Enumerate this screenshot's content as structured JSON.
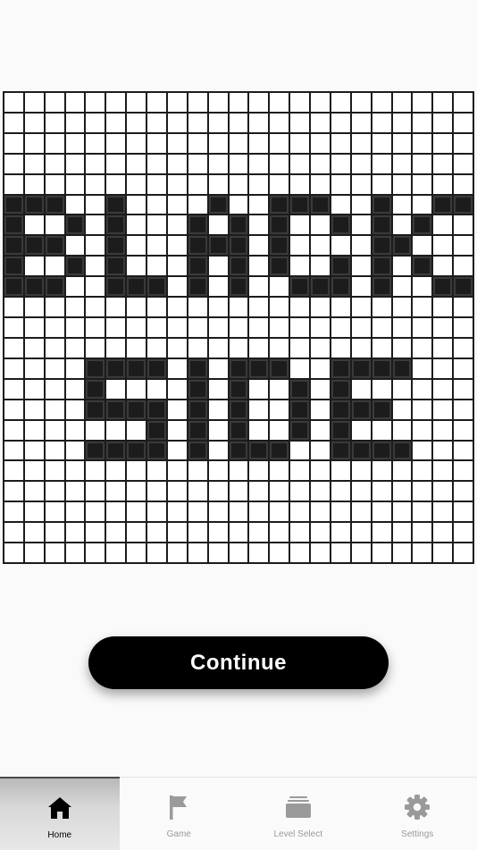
{
  "board": {
    "size": 23,
    "pattern": [
      ".......................",
      ".......................",
      ".......................",
      ".......................",
      ".......................",
      "###..#....#..###..#..##",
      "#..#.#...#.#.#..#.#.#..",
      "###..#...###.#....##...",
      "#..#.#...#.#.#..#.#.#..",
      "###..###.#.#..###.#..##",
      ".......................",
      ".......................",
      ".......................",
      "....####.#.###..####...",
      "....#....#.#..#.#......",
      "....####.#.#..#.###....",
      ".......#.#.#..#.#......",
      "....####.#.###..####...",
      ".......................",
      ".......................",
      ".......................",
      ".......................",
      "......................."
    ]
  },
  "continue_button": {
    "label": "Continue"
  },
  "nav": {
    "items": [
      {
        "label": "Home",
        "icon": "home-icon",
        "active": true
      },
      {
        "label": "Game",
        "icon": "flag-icon",
        "active": false
      },
      {
        "label": "Level Select",
        "icon": "stack-icon",
        "active": false
      },
      {
        "label": "Settings",
        "icon": "gear-icon",
        "active": false
      }
    ]
  },
  "colors": {
    "active_icon": "#000000",
    "inactive_icon": "#9a9a9a",
    "filled_cell": "#1c1c1c",
    "button": "#000000"
  }
}
